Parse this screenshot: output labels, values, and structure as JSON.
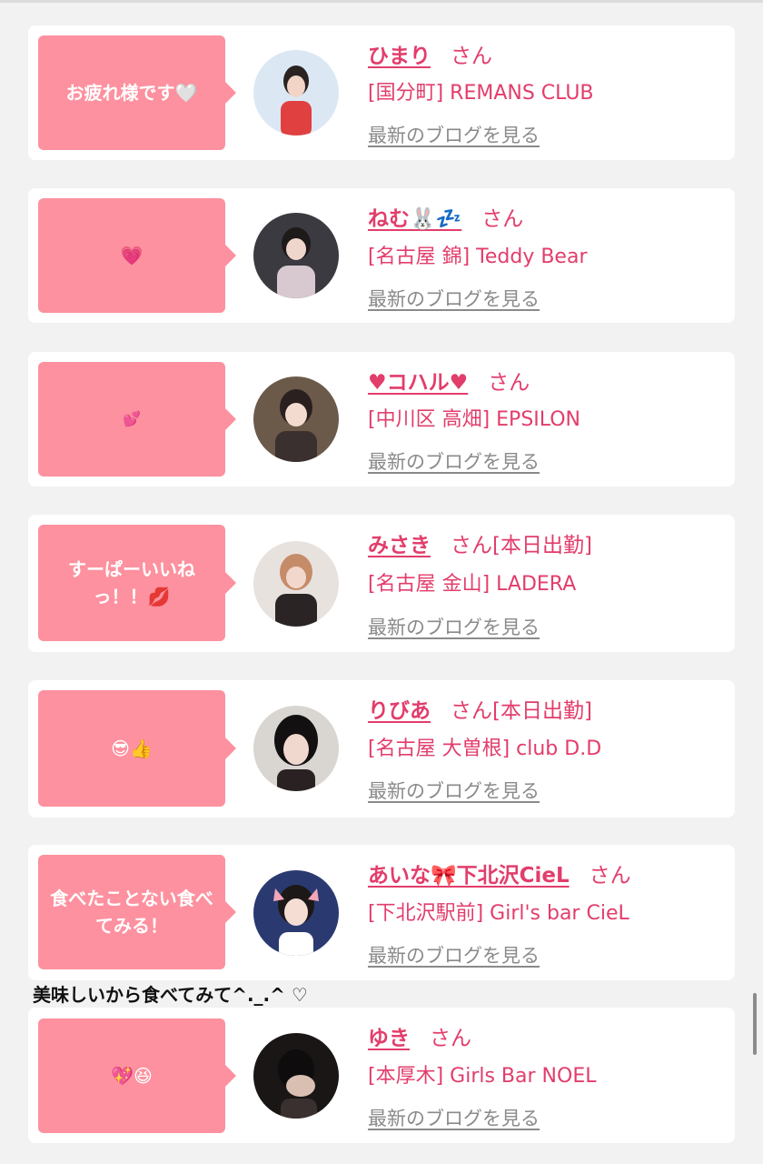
{
  "items": [
    {
      "bubble": "お疲れ様です🤍",
      "name": "ひまり",
      "suffix": "さん",
      "extra": "",
      "shop": "[国分町] REMANS CLUB",
      "blog": "最新のブログを見る"
    },
    {
      "bubble": "💗",
      "name": "ねむ🐰💤",
      "suffix": "さん",
      "extra": "",
      "shop": "[名古屋 錦] Teddy Bear",
      "blog": "最新のブログを見る"
    },
    {
      "bubble": "💕",
      "name": "♥コハル♥",
      "suffix": "さん",
      "extra": "",
      "shop": "[中川区 高畑] EPSILON",
      "blog": "最新のブログを見る"
    },
    {
      "bubble": "すーぱーいいねっ！！💋",
      "name": "みさき",
      "suffix": "さん",
      "extra": "[本日出勤]",
      "shop": "[名古屋 金山] LADERA",
      "blog": "最新のブログを見る"
    },
    {
      "bubble": "😎👍",
      "name": "りびあ",
      "suffix": "さん",
      "extra": "[本日出勤]",
      "shop": "[名古屋 大曽根] club D.D",
      "blog": "最新のブログを見る"
    },
    {
      "bubble": "食べたことない食べてみる！",
      "name": "あいな🎀下北沢CieL",
      "suffix": "さん",
      "extra": "",
      "shop": "[下北沢駅前] Girl's bar CieL",
      "blog": "最新のブログを見る"
    },
    {
      "bubble": "💖😆",
      "name": "ゆき",
      "suffix": "さん",
      "extra": "",
      "shop": "[本厚木] Girls Bar NOEL",
      "blog": "最新のブログを見る"
    }
  ],
  "comment": "美味しいから食べてみて^._.^ ♡",
  "colors": {
    "bubble": "#fd919f",
    "name": "#e23d6b",
    "blog": "#8a8a8a",
    "background": "#f2f2f2"
  }
}
